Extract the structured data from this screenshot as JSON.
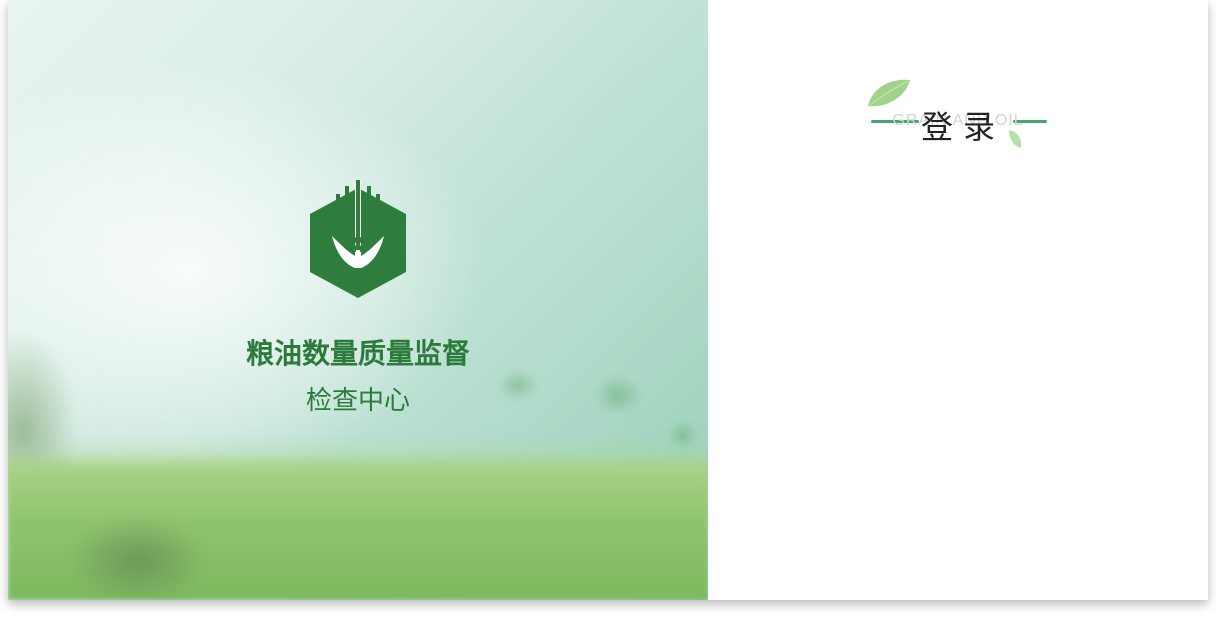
{
  "brand": {
    "logo_icon": "wheat-hexagon-logo",
    "title": "粮油数量质量监督",
    "subtitle": "检查中心",
    "color": "#2c7a3c"
  },
  "login": {
    "title": "登录",
    "watermark": "GRAIN AND OIL",
    "accent_color": "#3faa6a",
    "decor_icons": [
      "leaf-icon",
      "small-leaf-icon"
    ]
  }
}
